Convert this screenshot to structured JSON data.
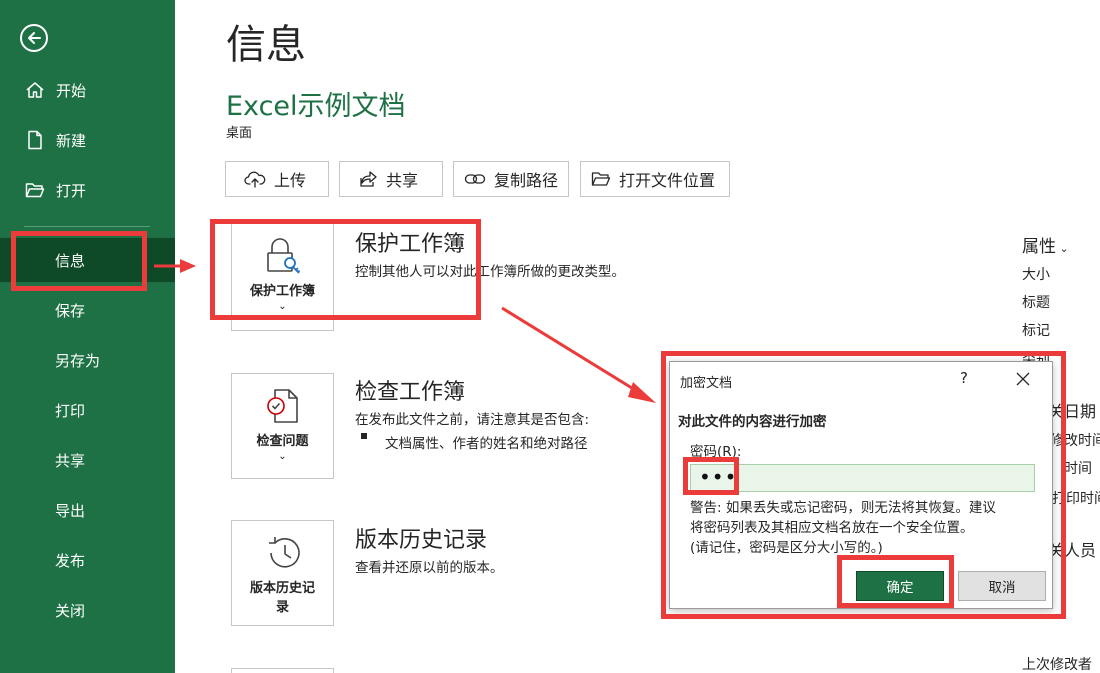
{
  "sidebar": {
    "items": [
      {
        "label": "开始",
        "icon": "home-icon"
      },
      {
        "label": "新建",
        "icon": "new-file-icon"
      },
      {
        "label": "打开",
        "icon": "open-folder-icon"
      },
      {
        "label": "信息"
      },
      {
        "label": "保存"
      },
      {
        "label": "另存为"
      },
      {
        "label": "打印"
      },
      {
        "label": "共享"
      },
      {
        "label": "导出"
      },
      {
        "label": "发布"
      },
      {
        "label": "关闭"
      }
    ],
    "active": "信息"
  },
  "main": {
    "title": "信息",
    "doc_name": "Excel示例文档",
    "doc_location": "桌面",
    "actions": [
      {
        "label": "上传",
        "icon": "upload-cloud-icon"
      },
      {
        "label": "共享",
        "icon": "share-icon"
      },
      {
        "label": "复制路径",
        "icon": "link-icon"
      },
      {
        "label": "打开文件位置",
        "icon": "folder-icon"
      }
    ],
    "sections": [
      {
        "tile_label": "保护工作簿",
        "title": "保护工作簿",
        "desc": "控制其他人可以对此工作簿所做的更改类型。"
      },
      {
        "tile_label": "检查问题",
        "title": "检查工作簿",
        "desc": "在发布此文件之前，请注意其是否包含:",
        "bullet": "文档属性、作者的姓名和绝对路径"
      },
      {
        "tile_label_line1": "版本历史记",
        "tile_label_line2": "录",
        "title": "版本历史记录",
        "desc": "查看并还原以前的版本。"
      }
    ]
  },
  "properties": {
    "header": "属性",
    "items": [
      "大小",
      "标题",
      "标记",
      "类别"
    ],
    "related_dates_partial": "关日期",
    "modified_partial": "修改时间",
    "created_partial": "时间",
    "printed_partial": "打印时间",
    "people_partial": "关人员",
    "last_modified_by": "上次修改者"
  },
  "dialog": {
    "title": "加密文档",
    "help": "?",
    "heading": "对此文件的内容进行加密",
    "password_label": "密码(R):",
    "password_value": "•••",
    "warning_line1": "警告: 如果丢失或忘记密码，则无法将其恢复。建议",
    "warning_line2": "将密码列表及其相应文档名放在一个安全位置。",
    "warning_line3": "(请记住，密码是区分大小写的。)",
    "ok_label": "确定",
    "cancel_label": "取消"
  },
  "colors": {
    "sidebar_bg": "#1e7145",
    "sidebar_active": "#0e4a28",
    "accent_green": "#1e7145",
    "highlight_red": "#ec3b3b"
  }
}
